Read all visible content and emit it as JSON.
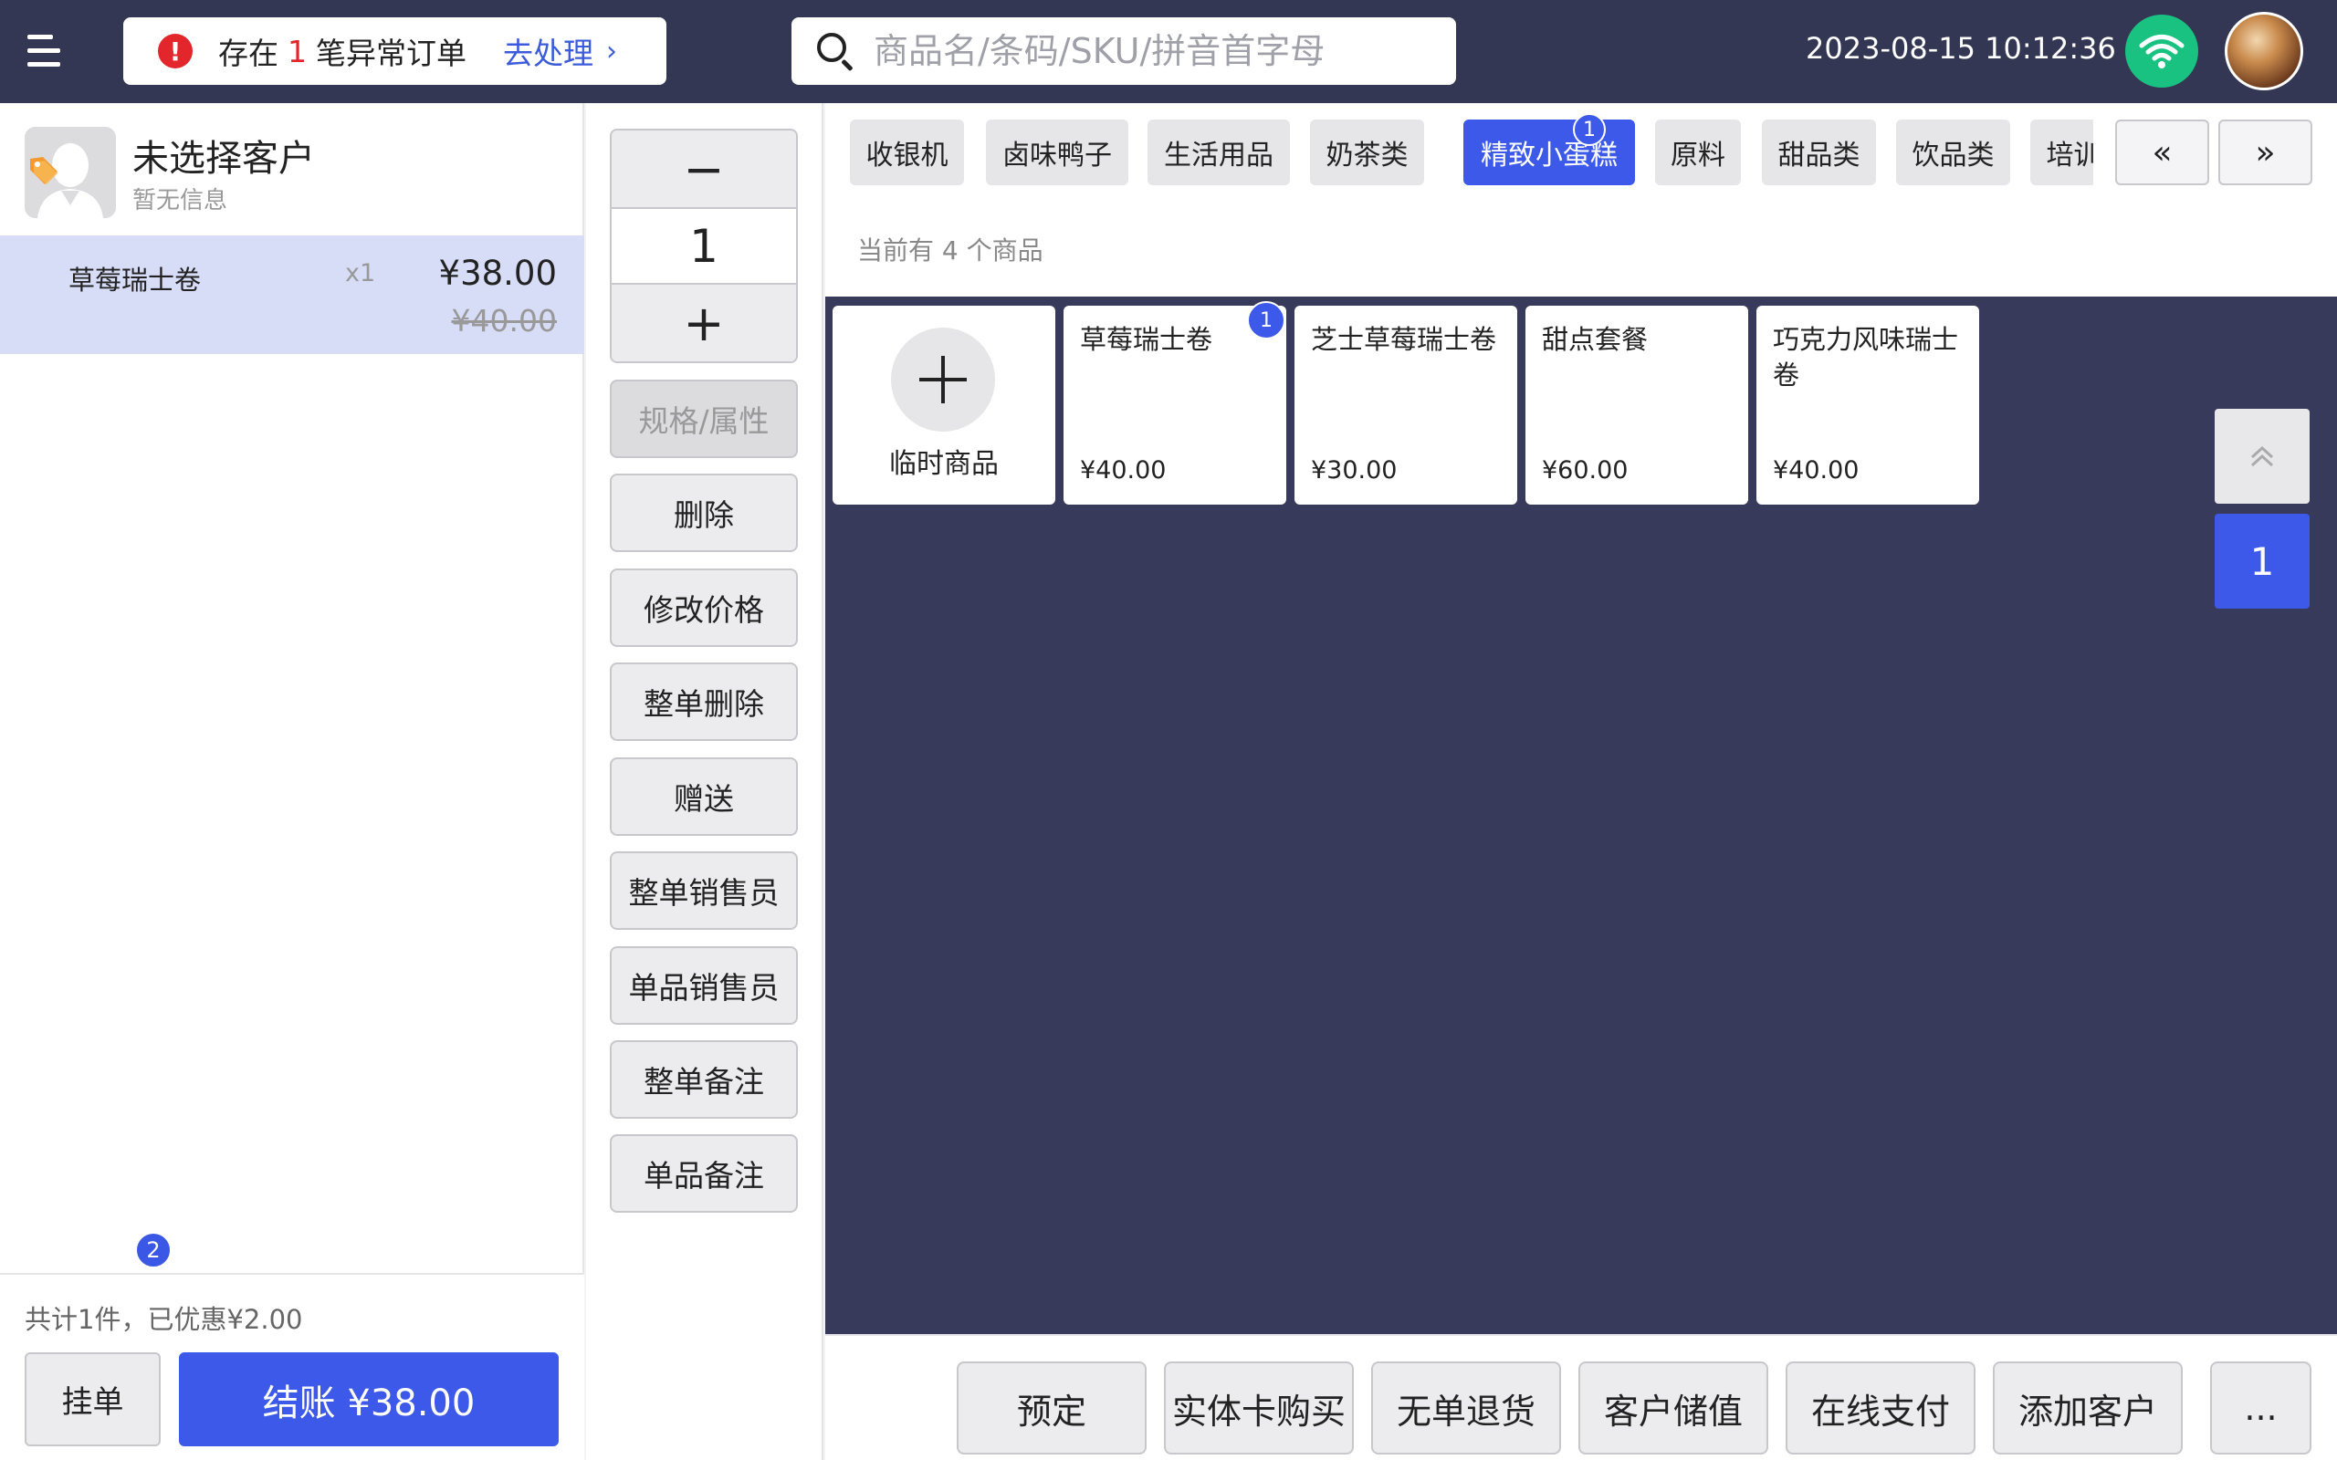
{
  "header": {
    "alert_pre": "存在",
    "alert_count": "1",
    "alert_post": "笔异常订单",
    "alert_link": "去处理",
    "search_placeholder": "商品名/条码/SKU/拼音首字母",
    "datetime": "2023-08-15 10:12:36"
  },
  "customer": {
    "name": "未选择客户",
    "info": "暂无信息"
  },
  "cart": {
    "items": [
      {
        "name": "草莓瑞士卷",
        "qty": "x1",
        "price": "¥38.00",
        "original_price": "¥40.00"
      }
    ],
    "summary": "共计1件，已优惠¥2.00",
    "hold_label": "挂单",
    "hold_badge": "2",
    "checkout_label": "结账 ¥38.00"
  },
  "stepper": {
    "minus": "−",
    "value": "1",
    "plus": "+"
  },
  "actions": [
    "规格/属性",
    "删除",
    "修改价格",
    "整单删除",
    "赠送",
    "整单销售员",
    "单品销售员",
    "整单备注",
    "单品备注"
  ],
  "categories": {
    "items": [
      "收银机",
      "卤味鸭子",
      "生活用品",
      "奶茶类",
      "精致小蛋糕",
      "原料",
      "甜品类",
      "饮品类",
      "培训类"
    ],
    "active_index": 4,
    "active_badge": "1",
    "prev_label": "«",
    "next_label": "»"
  },
  "products": {
    "count_text": "当前有 4 个商品",
    "temp_label": "临时商品",
    "items": [
      {
        "name": "草莓瑞士卷",
        "price": "¥40.00",
        "badge": "1"
      },
      {
        "name": "芝士草莓瑞士卷",
        "price": "¥30.00"
      },
      {
        "name": "甜点套餐",
        "price": "¥60.00"
      },
      {
        "name": "巧克力风味瑞士卷",
        "price": "¥40.00"
      }
    ]
  },
  "pagination": {
    "current": "1"
  },
  "bottom_actions": [
    "预定",
    "实体卡购买",
    "无单退货",
    "客户储值",
    "在线支付",
    "添加客户",
    "..."
  ],
  "colors": {
    "primary": "#3d59ea",
    "topbar": "#343753",
    "grid_bg": "#373a5a",
    "alert": "#e3262b",
    "wifi": "#19c281"
  }
}
